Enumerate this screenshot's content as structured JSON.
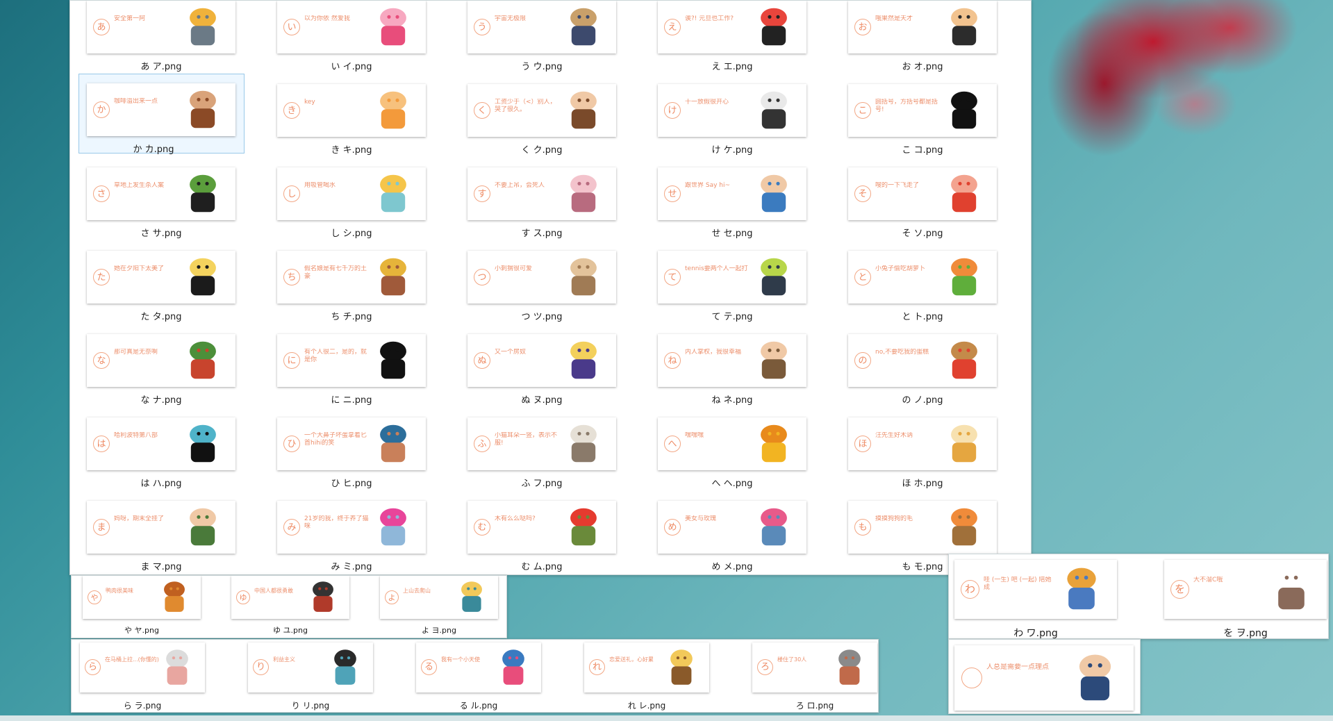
{
  "background": {
    "desktop_colors": [
      "#1d6f7d",
      "#86c4c8"
    ],
    "flower_color": "#c41228"
  },
  "main_window": {
    "files": [
      {
        "label": "あ ア.png",
        "icon": "construction-building-icon",
        "text": "安全第一阿"
      },
      {
        "label": "い イ.png",
        "icon": "love-heart-text-icon",
        "text": "以为你依 然爱我"
      },
      {
        "label": "う ウ.png",
        "icon": "night-landscape-icon",
        "text": "宇宙无极限"
      },
      {
        "label": "え エ.png",
        "icon": "glasses-man-icon",
        "text": "诶?! 元旦也工作?"
      },
      {
        "label": "お オ.png",
        "icon": "suited-man-icon",
        "text": "哦果然是天才"
      },
      {
        "label": "か カ.png",
        "icon": "coffee-cup-icon",
        "text": "咖啡溢出来一点"
      },
      {
        "label": "き キ.png",
        "icon": "orange-kana-ki-icon",
        "text": "key"
      },
      {
        "label": "く ク.png",
        "icon": "lying-girl-icon",
        "text": "工资少于（<）别人，哭了很久。"
      },
      {
        "label": "け ケ.png",
        "icon": "dancing-couple-icon",
        "text": "十一放假很开心"
      },
      {
        "label": "こ コ.png",
        "icon": "math-formula-icon",
        "text": "圆括号，方括号都是括号!"
      },
      {
        "label": "さ サ.png",
        "icon": "gunman-icon",
        "text": "草地上发生杀人案"
      },
      {
        "label": "し シ.png",
        "icon": "juice-glass-icon",
        "text": "用吸管喝水"
      },
      {
        "label": "す ス.png",
        "icon": "hanging-tree-icon",
        "text": "不要上吊，会死人"
      },
      {
        "label": "せ セ.png",
        "icon": "waving-boy-icon",
        "text": "跟世界 Say hi~"
      },
      {
        "label": "そ ソ.png",
        "icon": "red-kana-so-icon",
        "text": "嗖的一下飞走了"
      },
      {
        "label": "た タ.png",
        "icon": "palm-beach-icon",
        "text": "她在夕阳下太美了"
      },
      {
        "label": "ち チ.png",
        "icon": "girl-money-bag-icon",
        "text": "假名娘是有七千万的土豪"
      },
      {
        "label": "つ ツ.png",
        "icon": "hedgehog-icon",
        "text": "小刺猬很可爱"
      },
      {
        "label": "て テ.png",
        "icon": "tennis-racket-icon",
        "text": "tennis要两个人一起打"
      },
      {
        "label": "と ト.png",
        "icon": "rabbit-carrot-icon",
        "text": "小兔子偷吃胡萝卜"
      },
      {
        "label": "な ナ.png",
        "icon": "hat-boy-icon",
        "text": "那可真是无奈啊"
      },
      {
        "label": "に ニ.png",
        "icon": "calligraphy-icon",
        "text": "有个人很二，是的，就是你"
      },
      {
        "label": "ぬ ヌ.png",
        "icon": "purple-monster-icon",
        "text": "又一个房奴"
      },
      {
        "label": "ね ネ.png",
        "icon": "hugging-couple-icon",
        "text": "内人掌权，我很幸福"
      },
      {
        "label": "の ノ.png",
        "icon": "no-cake-icon",
        "text": "no,不要吃我的蛋糕"
      },
      {
        "label": "は ハ.png",
        "icon": "glasses-girl-icon",
        "text": "哈利波特第八部"
      },
      {
        "label": "ひ ヒ.png",
        "icon": "big-nose-man-icon",
        "text": "一个大鼻子坏蛋拿着匕首hihi的笑"
      },
      {
        "label": "ふ フ.png",
        "icon": "grumpy-cat-icon",
        "text": "小猫耳朵一竖，表示不服!"
      },
      {
        "label": "へ ヘ.png",
        "icon": "smiley-face-icon",
        "text": "嘿嘿嘿"
      },
      {
        "label": "ほ ホ.png",
        "icon": "doge-icon",
        "text": "汪先生好木讷"
      },
      {
        "label": "ま マ.png",
        "icon": "exam-girl-icon",
        "text": "妈呀，期末全挂了"
      },
      {
        "label": "み ミ.png",
        "icon": "blue-cat-icon",
        "text": "21岁的我，终于养了猫咪"
      },
      {
        "label": "む ム.png",
        "icon": "no-girl-icon",
        "text": "木有么么哒吗?"
      },
      {
        "label": "め メ.png",
        "icon": "flower-girl-icon",
        "text": "美女与玫瑰"
      },
      {
        "label": "も モ.png",
        "icon": "old-man-dog-icon",
        "text": "摸摸狗狗的毛"
      }
    ]
  },
  "ya_window": {
    "files": [
      {
        "label": "や ヤ.png",
        "icon": "roast-chicken-icon",
        "text": "鸭肉很美味"
      },
      {
        "label": "ゆ ユ.png",
        "icon": "running-man-icon",
        "text": "中国人都很勇敢"
      },
      {
        "label": "よ ヨ.png",
        "icon": "mountain-icon",
        "text": "上山去爬山"
      }
    ]
  },
  "ra_window": {
    "files": [
      {
        "label": "ら ラ.png",
        "icon": "kana-ra-icon",
        "text": "在马桶上拉...(你懂的)"
      },
      {
        "label": "り リ.png",
        "icon": "world-map-icon",
        "text": "利益主义"
      },
      {
        "label": "る ル.png",
        "icon": "crowd-icon",
        "text": "我有一个小天使"
      },
      {
        "label": "れ レ.png",
        "icon": "delivery-man-icon",
        "text": "恋爱送礼，心好累"
      },
      {
        "label": "ろ ロ.png",
        "icon": "building-icon",
        "text": "楼住了30人"
      }
    ]
  },
  "wa_window": {
    "files": [
      {
        "label": "わ ワ.png",
        "icon": "farmer-icon",
        "text": "哇 (一生) 吧 (一起) 陪她成"
      },
      {
        "label": "を ヲ.png",
        "icon": "wc-sign-icon",
        "text": "大不溜C哦"
      }
    ]
  },
  "n_window": {
    "files": [
      {
        "label": "",
        "icon": "thinking-man-icon",
        "text": "人总是需要一点理点"
      }
    ]
  }
}
